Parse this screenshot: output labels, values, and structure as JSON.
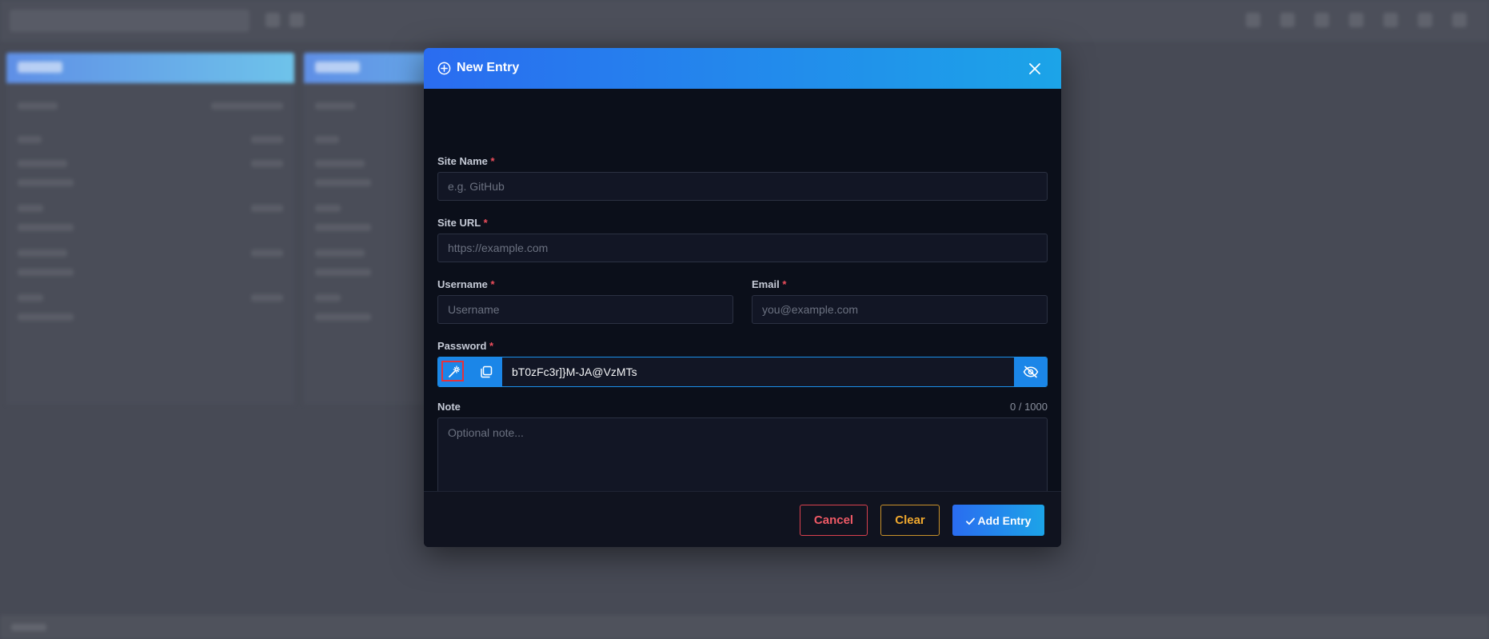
{
  "modal": {
    "title": "New Entry",
    "icons": {
      "header": "plus-circle-icon",
      "close": "close-icon",
      "generate": "magic-wand-icon",
      "copy": "copy-icon",
      "visibility": "eye-off-icon",
      "submit": "check-icon"
    },
    "fields": {
      "site_name": {
        "label": "Site Name",
        "required_mark": "*",
        "placeholder": "e.g. GitHub",
        "value": ""
      },
      "site_url": {
        "label": "Site URL",
        "required_mark": "*",
        "placeholder": "https://example.com",
        "value": ""
      },
      "username": {
        "label": "Username",
        "required_mark": "*",
        "placeholder": "Username",
        "value": ""
      },
      "email": {
        "label": "Email",
        "required_mark": "*",
        "placeholder": "you@example.com",
        "value": ""
      },
      "password": {
        "label": "Password",
        "required_mark": "*",
        "value": "bT0zFc3r]}M-JA@VzMTs"
      },
      "note": {
        "label": "Note",
        "counter": "0 / 1000",
        "placeholder": "Optional note...",
        "value": ""
      }
    },
    "buttons": {
      "cancel": "Cancel",
      "clear": "Clear",
      "add": "Add Entry"
    }
  },
  "colors": {
    "header_gradient_start": "#2a6cf0",
    "header_gradient_end": "#1ca4e8",
    "modal_bg": "#0b0f1a",
    "cancel": "#ef5a66",
    "clear": "#f1a92e",
    "required": "#ef4e5c"
  }
}
